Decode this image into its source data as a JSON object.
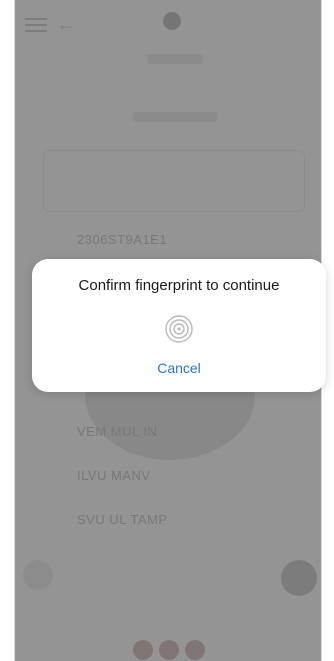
{
  "app": {
    "background_fields": [
      {
        "label": "",
        "value": "2306ST9A1E1"
      },
      {
        "label": "",
        "value": "VEM MUL IN"
      },
      {
        "label": "",
        "value": "ILVU MANV"
      },
      {
        "label": "",
        "value": "SVU UL TAMP"
      }
    ]
  },
  "dialog": {
    "title": "Confirm fingerprint to continue",
    "icon": "fingerprint-icon",
    "cancel_label": "Cancel"
  },
  "colors": {
    "accent": "#2a76c6",
    "scrim": "rgba(0,0,0,0.38)",
    "dialog_bg": "#ffffff"
  }
}
